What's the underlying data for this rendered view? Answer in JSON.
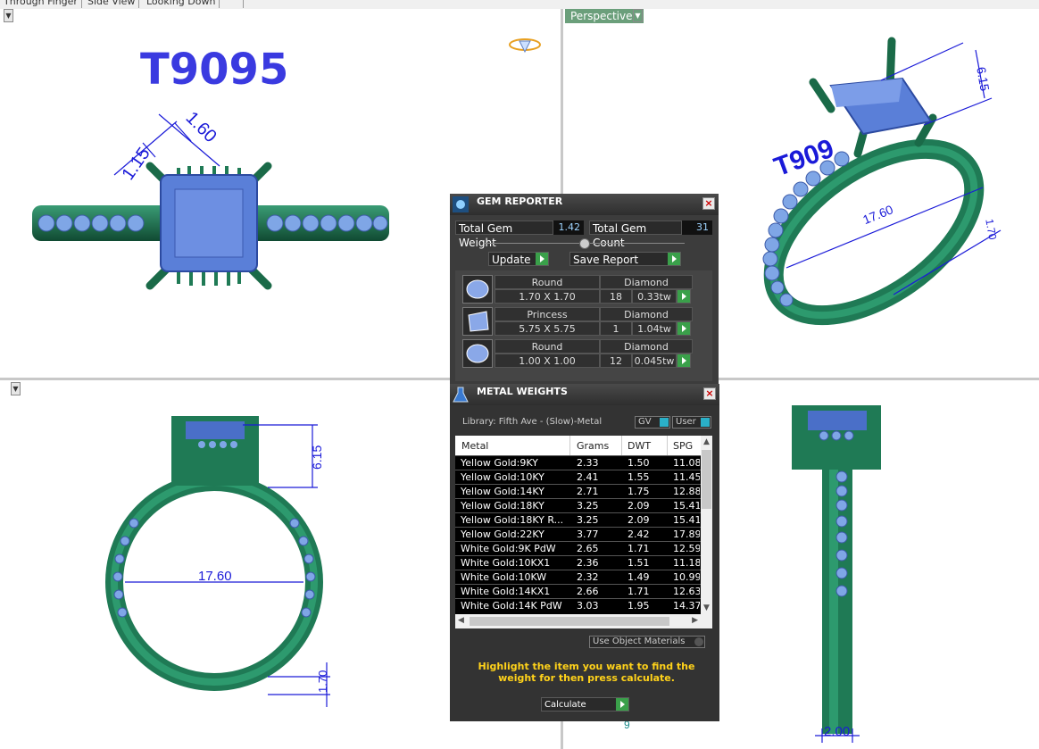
{
  "view_tabs": [
    "Through Finger",
    "Side View",
    "Looking Down"
  ],
  "viewports": {
    "top_left": {
      "model_name": "T9095",
      "dim_left": "1.15",
      "dim_right": "1.60"
    },
    "top_right": {
      "label": "Perspective",
      "engraving": "T909",
      "dim_height": "6.15",
      "dim_diameter": "17.60",
      "dim_band": "1.70"
    },
    "bottom_left": {
      "dim_height": "6.15",
      "dim_diameter": "17.60",
      "dim_band": "1.70"
    },
    "bottom_right": {
      "dim_width": "2.00"
    }
  },
  "gem_reporter": {
    "title": "GEM REPORTER",
    "total_weight_label": "Total Gem Weight",
    "total_weight": "1.42",
    "total_count_label": "Total Gem Count",
    "total_count": "31",
    "update_label": "Update",
    "save_label": "Save Report",
    "gems": [
      {
        "shape": "Round",
        "size": "1.70 X 1.70",
        "material": "Diamond",
        "count": "18",
        "weight": "0.33tw"
      },
      {
        "shape": "Princess",
        "size": "5.75 X 5.75",
        "material": "Diamond",
        "count": "1",
        "weight": "1.04tw"
      },
      {
        "shape": "Round",
        "size": "1.00 X 1.00",
        "material": "Diamond",
        "count": "12",
        "weight": "0.045tw"
      }
    ]
  },
  "metal_weights": {
    "title": "METAL WEIGHTS",
    "library": "Library: Fifth Ave - (Slow)-Metal",
    "gv_label": "GV",
    "user_label": "User",
    "columns": [
      "Metal",
      "Grams",
      "DWT",
      "SPG"
    ],
    "rows": [
      [
        "Yellow Gold:9KY",
        "2.33",
        "1.50",
        "11.08"
      ],
      [
        "Yellow Gold:10KY",
        "2.41",
        "1.55",
        "11.45"
      ],
      [
        "Yellow Gold:14KY",
        "2.71",
        "1.75",
        "12.88"
      ],
      [
        "Yellow Gold:18KY",
        "3.25",
        "2.09",
        "15.41"
      ],
      [
        "Yellow Gold:18KY R...",
        "3.25",
        "2.09",
        "15.41"
      ],
      [
        "Yellow Gold:22KY",
        "3.77",
        "2.42",
        "17.89"
      ],
      [
        "White Gold:9K PdW",
        "2.65",
        "1.71",
        "12.59"
      ],
      [
        "White Gold:10KX1",
        "2.36",
        "1.51",
        "11.18"
      ],
      [
        "White Gold:10KW",
        "2.32",
        "1.49",
        "10.99"
      ],
      [
        "White Gold:14KX1",
        "2.66",
        "1.71",
        "12.63"
      ],
      [
        "White Gold:14K PdW",
        "3.03",
        "1.95",
        "14.37"
      ]
    ],
    "use_object_label": "Use Object Materials",
    "hint": "Highlight the item you want to find the weight for then press calculate.",
    "calculate_label": "Calculate"
  },
  "colors": {
    "metal": "#1f7a55",
    "gem": "#5a7fd8",
    "dimension": "#1a1ad8",
    "model_text": "#3a3ae0",
    "hint": "#ffd21a",
    "panel": "#3c3c3c"
  }
}
